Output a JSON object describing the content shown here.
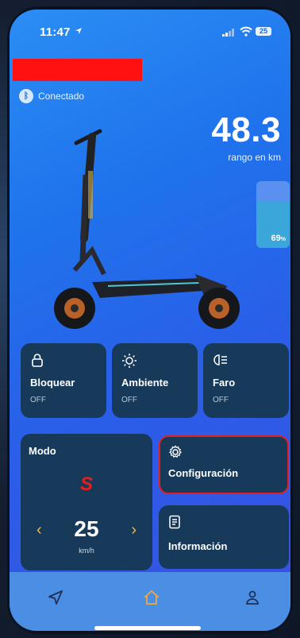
{
  "status_bar": {
    "time": "11:47",
    "battery": "25"
  },
  "connection": {
    "icon": "bluetooth-icon",
    "label": "Conectado"
  },
  "range": {
    "value": "48.3",
    "label": "rango en km"
  },
  "battery": {
    "percent": 69,
    "label": "69",
    "unit": "%"
  },
  "toggles": [
    {
      "icon": "lock-icon",
      "title": "Bloquear",
      "status": "OFF"
    },
    {
      "icon": "sun-icon",
      "title": "Ambiente",
      "status": "OFF"
    },
    {
      "icon": "headlight-icon",
      "title": "Faro",
      "status": "OFF"
    }
  ],
  "mode": {
    "title": "Modo",
    "value": "S",
    "speed": "25",
    "unit": "km/h",
    "prev": "‹",
    "next": "›"
  },
  "settings": {
    "icon": "gear-icon",
    "label": "Configuración"
  },
  "info": {
    "icon": "document-icon",
    "label": "Información"
  },
  "nav": [
    {
      "icon": "navigation-icon"
    },
    {
      "icon": "home-icon"
    },
    {
      "icon": "profile-icon"
    }
  ],
  "colors": {
    "accent_red": "#e41e1e",
    "card_bg": "#173a5a",
    "highlight_border": "#e02020",
    "battery_fill": "#3aa6d9"
  }
}
